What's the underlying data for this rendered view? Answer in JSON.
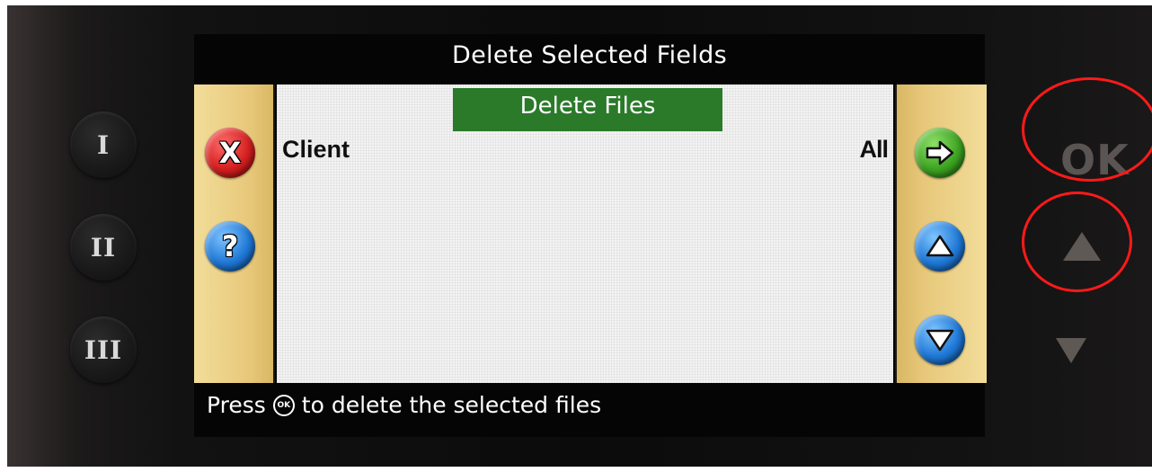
{
  "screen": {
    "title": "Delete Selected Fields",
    "header": "Delete Files",
    "row": {
      "label": "Client",
      "value": "All"
    },
    "status": {
      "prefix": "Press",
      "ok_icon": "OK",
      "suffix": "to delete the selected files"
    }
  },
  "hardware": {
    "left_buttons": [
      "I",
      "II",
      "III"
    ],
    "ok_label": "OK",
    "up_icon": "up-arrow-icon",
    "down_icon": "down-arrow-icon"
  },
  "side_buttons": {
    "left": [
      "cancel-x-icon",
      "help-question-icon"
    ],
    "right": [
      "next-arrow-icon",
      "up-arrow-icon",
      "down-arrow-icon"
    ]
  },
  "colors": {
    "header_bg": "#2a7a2a",
    "side_panel": "#e7c87a",
    "highlight_circle": "#ff1a1a"
  }
}
